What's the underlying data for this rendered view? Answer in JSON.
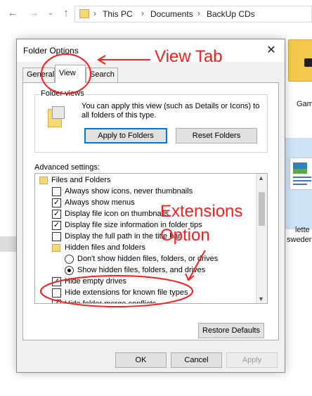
{
  "explorer": {
    "breadcrumbs": [
      "This PC",
      "Documents",
      "BackUp CDs"
    ],
    "separator": "›",
    "files": [
      {
        "label": "Gam"
      },
      {
        "label_line1": "lette",
        "label_line2": "sweder"
      }
    ]
  },
  "dialog": {
    "title": "Folder Options",
    "close_glyph": "✕",
    "tabs": [
      {
        "label": "General"
      },
      {
        "label": "View"
      },
      {
        "label": "Search"
      }
    ],
    "folder_views": {
      "title": "Folder views",
      "description": "You can apply this view (such as Details or Icons) to all folders of this type.",
      "apply_button": "Apply to Folders",
      "reset_button": "Reset Folders"
    },
    "advanced": {
      "label": "Advanced settings:",
      "items": [
        {
          "label": "Files and Folders",
          "type": "folder"
        },
        {
          "label": "Always show icons, never thumbnails",
          "type": "checkbox",
          "checked": false
        },
        {
          "label": "Always show menus",
          "type": "checkbox",
          "checked": true
        },
        {
          "label": "Display file icon on thumbnails",
          "type": "checkbox",
          "checked": true
        },
        {
          "label": "Display file size information in folder tips",
          "type": "checkbox",
          "checked": true
        },
        {
          "label": "Display the full path in the title bar",
          "type": "checkbox",
          "checked": false
        },
        {
          "label": "Hidden files and folders",
          "type": "folder"
        },
        {
          "label": "Don't show hidden files, folders, or drives",
          "type": "radio",
          "checked": false
        },
        {
          "label": "Show hidden files, folders, and drives",
          "type": "radio",
          "checked": true
        },
        {
          "label": "Hide empty drives",
          "type": "checkbox",
          "checked": true
        },
        {
          "label": "Hide extensions for known file types",
          "type": "checkbox",
          "checked": false
        },
        {
          "label": "Hide folder merge conflicts",
          "type": "checkbox",
          "checked": true
        }
      ],
      "restore_button": "Restore Defaults"
    },
    "buttons": {
      "ok": "OK",
      "cancel": "Cancel",
      "apply": "Apply"
    }
  },
  "annotations": {
    "view_tab": "View Tab",
    "extensions_line1": "Extensions",
    "extensions_line2": "Option",
    "color": "#ff1c1c"
  }
}
